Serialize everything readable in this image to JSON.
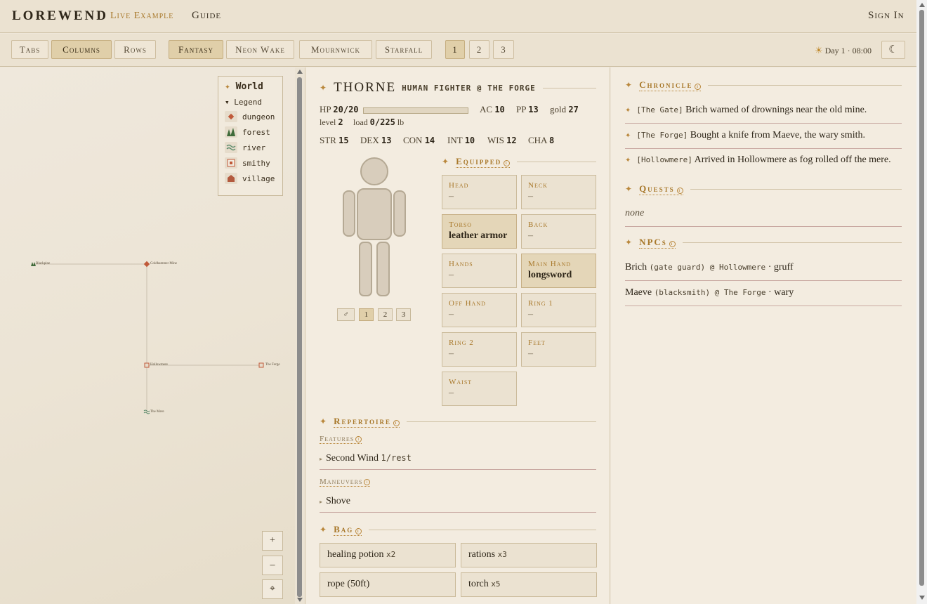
{
  "nav": {
    "brand": "LOREWEND",
    "live_example": "Live Example",
    "guide": "Guide",
    "sign_in": "Sign In"
  },
  "toolbar": {
    "layouts": [
      "Tabs",
      "Columns",
      "Rows"
    ],
    "active_layout": "Columns",
    "worlds": [
      "Fantasy",
      "Neon Wake",
      "Mournwick",
      "Starfall"
    ],
    "active_world": "Fantasy",
    "slots": [
      "1",
      "2",
      "3"
    ],
    "active_slot": "1",
    "day": "Day 1 · 08:00",
    "sun_icon": "☀",
    "theme_icon": "☾",
    "theme_icon_name": "moon-icon"
  },
  "map": {
    "legend_title": "World",
    "legend_toggle": "Legend",
    "legend_items": [
      {
        "label": "dungeon",
        "icon": "dungeon-icon",
        "color": "#c05a3a"
      },
      {
        "label": "forest",
        "icon": "forest-icon",
        "color": "#3f6b3a"
      },
      {
        "label": "river",
        "icon": "river-icon",
        "color": "#5a8a6a"
      },
      {
        "label": "smithy",
        "icon": "smithy-icon",
        "color": "#c05a3a"
      },
      {
        "label": "village",
        "icon": "village-icon",
        "color": "#b35a3e"
      }
    ],
    "locations": [
      "Blackpine",
      "Coldhammer Mine",
      "Hollowmere",
      "The Forge",
      "The Mere"
    ],
    "zoom_in": "+",
    "zoom_out": "–",
    "recenter": "⌖"
  },
  "character": {
    "name": "THORNE",
    "subtitle": "HUMAN FIGHTER @ THE FORGE",
    "hp_label": "HP",
    "hp": "20/20",
    "hp_fraction": 1.0,
    "ac_label": "AC",
    "ac": "10",
    "pp_label": "PP",
    "pp": "13",
    "gold_label": "gold",
    "gold": "27",
    "level_label": "level",
    "level": "2",
    "load_label": "load",
    "load": "0/225",
    "load_unit": "lb",
    "abilities": [
      {
        "k": "STR",
        "v": "15"
      },
      {
        "k": "DEX",
        "v": "13"
      },
      {
        "k": "CON",
        "v": "14"
      },
      {
        "k": "INT",
        "v": "10"
      },
      {
        "k": "WIS",
        "v": "12"
      },
      {
        "k": "CHA",
        "v": "8"
      }
    ],
    "figure_buttons": [
      "♂",
      "1",
      "2",
      "3"
    ],
    "equipped_label": "Equipped",
    "slots": [
      {
        "name": "Head",
        "value": "–",
        "filled": false
      },
      {
        "name": "Neck",
        "value": "–",
        "filled": false
      },
      {
        "name": "Torso",
        "value": "leather armor",
        "filled": true
      },
      {
        "name": "Back",
        "value": "–",
        "filled": false
      },
      {
        "name": "Hands",
        "value": "–",
        "filled": false
      },
      {
        "name": "Main Hand",
        "value": "longsword",
        "filled": true
      },
      {
        "name": "Off Hand",
        "value": "–",
        "filled": false
      },
      {
        "name": "Ring 1",
        "value": "–",
        "filled": false
      },
      {
        "name": "Ring 2",
        "value": "–",
        "filled": false
      },
      {
        "name": "Feet",
        "value": "–",
        "filled": false
      },
      {
        "name": "Waist",
        "value": "–",
        "filled": false
      }
    ],
    "repertoire_label": "Repertoire",
    "features_label": "Features",
    "features": [
      {
        "name": "Second Wind",
        "uses": "1/rest"
      }
    ],
    "maneuvers_label": "Maneuvers",
    "maneuvers": [
      {
        "name": "Shove"
      }
    ],
    "bag_label": "Bag",
    "bag": [
      {
        "name": "healing potion",
        "qty": "x2"
      },
      {
        "name": "rations",
        "qty": "x3"
      },
      {
        "name": "rope (50ft)",
        "qty": ""
      },
      {
        "name": "torch",
        "qty": "x5"
      }
    ]
  },
  "chronicle": {
    "label": "Chronicle",
    "entries": [
      {
        "place": "[The Gate]",
        "text": "Brich warned of drownings near the old mine."
      },
      {
        "place": "[The Forge]",
        "text": "Bought a knife from Maeve, the wary smith."
      },
      {
        "place": "[Hollowmere]",
        "text": "Arrived in Hollowmere as fog rolled off the mere."
      }
    ],
    "quests_label": "Quests",
    "quests_empty": "none",
    "npcs_label": "NPCs",
    "npcs": [
      {
        "name": "Brich",
        "detail": "(gate guard) @ Hollowmere",
        "trait": "· gruff"
      },
      {
        "name": "Maeve",
        "detail": "(blacksmith) @ The Forge",
        "trait": "· wary"
      }
    ]
  },
  "info_icon": "ⓘ",
  "star_glyph": "✦"
}
